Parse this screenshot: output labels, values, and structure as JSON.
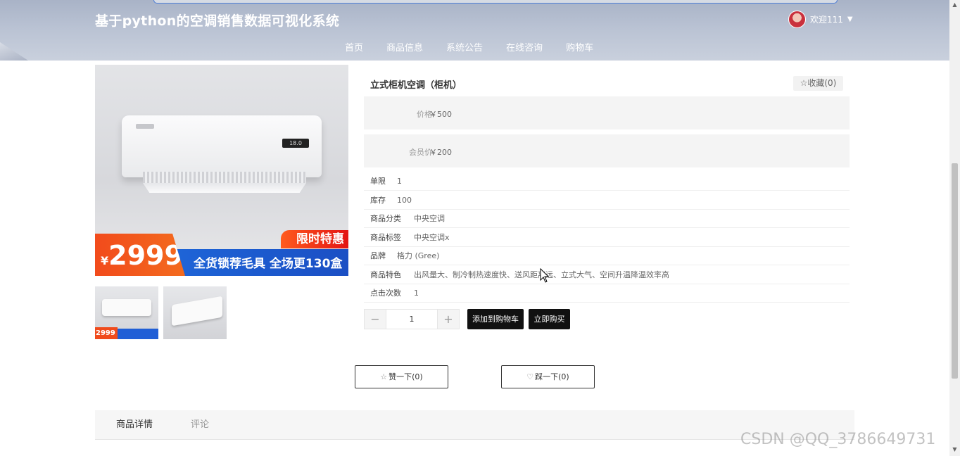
{
  "header": {
    "site_title": "基于python的空调销售数据可视化系统",
    "user_greeting": "欢迎111",
    "nav": [
      "首页",
      "商品信息",
      "系统公告",
      "在线咨询",
      "购物车"
    ]
  },
  "image": {
    "promo_tag": "限时特惠",
    "promo_yen": "¥",
    "promo_price": "2999",
    "promo_text": "全货锁荐毛具 全场更130盒",
    "display_text": "18.0",
    "thumb_price": "2999"
  },
  "product": {
    "name": "立式柜机空调（柜机）",
    "favorite": "☆收藏(0)",
    "price_label": "价格",
    "price_value": "￥500",
    "member_price_label": "会员价",
    "member_price_value": "￥200",
    "attributes": [
      {
        "label": "单限",
        "value": "1"
      },
      {
        "label": "库存",
        "value": "100"
      },
      {
        "label": "商品分类",
        "value": "中央空调"
      },
      {
        "label": "商品标签",
        "value": "中央空调x"
      },
      {
        "label": "品牌",
        "value": "格力 (Gree)"
      },
      {
        "label": "商品特色",
        "value": "出风量大、制冷制热速度快、送风距离远、立式大气、空间升温降温效率高"
      },
      {
        "label": "点击次数",
        "value": "1"
      }
    ]
  },
  "purchase": {
    "minus": "−",
    "quantity": "1",
    "plus": "+",
    "add_cart": "添加到购物车",
    "buy_now": "立即购买"
  },
  "reactions": {
    "like": "赞一下(0)",
    "dislike": "踩一下(0)"
  },
  "tabs": [
    "商品详情",
    "评论"
  ],
  "watermark": "CSDN @QQ_3786649731"
}
